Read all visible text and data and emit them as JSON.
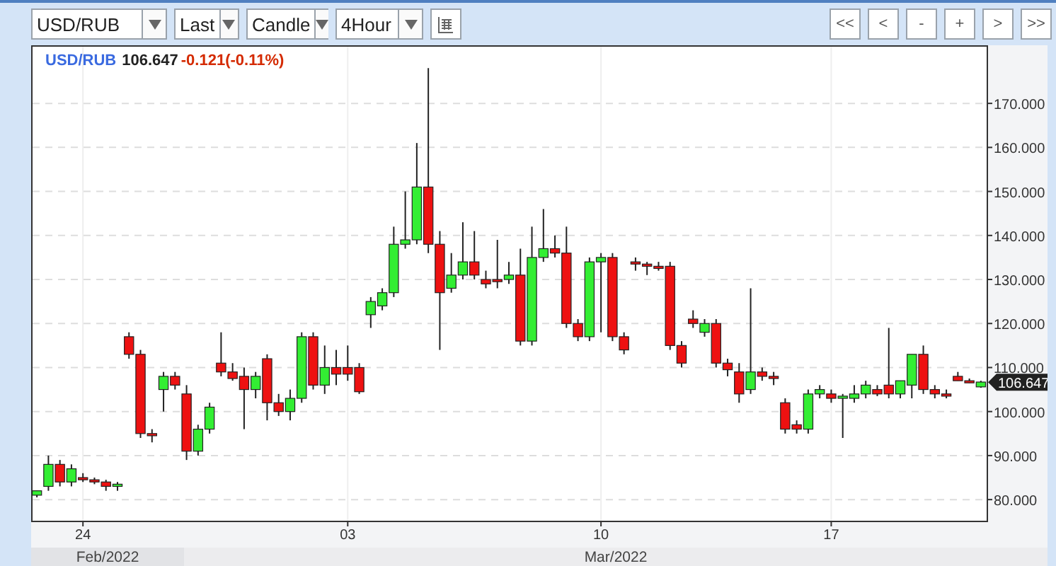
{
  "toolbar": {
    "selects": [
      {
        "value": "USD/RUB"
      },
      {
        "value": "Last"
      },
      {
        "value": "Candle"
      },
      {
        "value": "4Hour"
      }
    ],
    "nav_buttons": [
      "<<",
      "<",
      "-",
      "+",
      ">",
      ">>"
    ]
  },
  "chart": {
    "legend": {
      "symbol": "USD/RUB",
      "price": "106.647",
      "change": "-0.121(-0.11%)"
    },
    "current_price": "106.647",
    "months": [
      "Feb/2022",
      "Mar/2022"
    ],
    "chart_data": {
      "type": "candlestick",
      "grid": true,
      "ylim": [
        75.2,
        183.2
      ],
      "yticks": [
        {
          "value": 80,
          "label": "80.000"
        },
        {
          "value": 90,
          "label": "90.000"
        },
        {
          "value": 100,
          "label": "100.000"
        },
        {
          "value": 110,
          "label": "110.000"
        },
        {
          "value": 120,
          "label": "120.000"
        },
        {
          "value": 130,
          "label": "130.000"
        },
        {
          "value": 140,
          "label": "140.000"
        },
        {
          "value": 150,
          "label": "150.000"
        },
        {
          "value": 160,
          "label": "160.000"
        },
        {
          "value": 170,
          "label": "170.000"
        }
      ],
      "categories": [
        null,
        null,
        null,
        null,
        "24",
        null,
        null,
        null,
        null,
        null,
        null,
        null,
        null,
        null,
        null,
        null,
        null,
        null,
        null,
        null,
        null,
        null,
        null,
        null,
        null,
        null,
        null,
        "03",
        null,
        null,
        null,
        null,
        null,
        null,
        null,
        null,
        null,
        null,
        null,
        null,
        null,
        null,
        null,
        null,
        null,
        null,
        null,
        null,
        null,
        "10",
        null,
        null,
        null,
        null,
        null,
        null,
        null,
        null,
        null,
        null,
        null,
        null,
        null,
        null,
        null,
        null,
        null,
        null,
        null,
        "17",
        null,
        null,
        null,
        null,
        null,
        null,
        null,
        null,
        null,
        null,
        null,
        null,
        null
      ],
      "ohlc": [
        [
          81,
          82,
          80.5,
          82
        ],
        [
          83,
          90,
          82,
          88
        ],
        [
          88,
          89,
          83,
          84
        ],
        [
          84,
          88,
          83,
          87
        ],
        [
          85,
          86,
          84,
          84.5
        ],
        [
          84.5,
          85,
          83.5,
          84
        ],
        [
          84,
          84.5,
          82,
          83
        ],
        [
          83,
          84,
          82,
          83.5
        ],
        [
          117,
          118,
          112,
          113
        ],
        [
          113,
          114,
          94,
          95
        ],
        [
          95,
          96,
          93,
          94.5
        ],
        [
          105,
          109,
          100,
          108
        ],
        [
          108,
          109,
          105,
          106
        ],
        [
          104,
          106,
          89,
          91
        ],
        [
          91,
          97,
          90,
          96
        ],
        [
          96,
          102,
          95,
          101
        ],
        [
          111,
          118,
          108,
          109
        ],
        [
          109,
          111,
          107,
          107.5
        ],
        [
          108,
          110,
          96,
          105
        ],
        [
          105,
          109,
          103,
          108
        ],
        [
          112,
          113,
          98,
          102
        ],
        [
          102,
          104,
          99,
          100
        ],
        [
          100,
          105,
          98,
          103
        ],
        [
          103,
          118,
          102,
          117
        ],
        [
          117,
          118,
          105,
          106
        ],
        [
          106,
          115,
          104,
          110
        ],
        [
          110,
          114,
          106,
          108.5
        ],
        [
          110,
          115,
          107,
          108.5
        ],
        [
          110,
          111,
          104,
          104.5
        ],
        [
          122,
          126,
          119,
          125
        ],
        [
          124,
          128,
          123,
          127
        ],
        [
          127,
          142,
          126,
          138
        ],
        [
          138,
          150,
          137,
          139
        ],
        [
          139,
          161,
          138,
          151
        ],
        [
          151,
          178,
          136,
          138
        ],
        [
          138,
          141,
          114,
          127
        ],
        [
          128,
          136,
          127,
          131
        ],
        [
          131,
          143,
          130,
          134
        ],
        [
          134,
          141,
          130,
          131
        ],
        [
          130,
          132,
          128,
          129
        ],
        [
          130,
          139,
          128,
          129.5
        ],
        [
          130,
          134,
          129,
          131
        ],
        [
          131,
          137,
          115,
          116
        ],
        [
          116,
          142,
          115,
          135
        ],
        [
          135,
          146,
          134,
          137
        ],
        [
          137,
          140,
          135,
          136
        ],
        [
          136,
          142,
          119,
          120
        ],
        [
          120,
          121,
          116,
          117
        ],
        [
          117,
          135,
          116,
          134
        ],
        [
          134,
          136,
          118,
          135
        ],
        [
          135,
          136,
          116,
          117
        ],
        [
          117,
          118,
          113,
          114
        ],
        [
          134,
          135,
          132,
          133.5
        ],
        [
          133.5,
          134,
          131,
          133
        ],
        [
          133,
          134,
          132,
          132.5
        ],
        [
          133,
          134,
          114,
          115
        ],
        [
          115,
          116,
          110,
          111
        ],
        [
          121,
          123,
          119,
          120
        ],
        [
          118,
          121,
          117,
          120
        ],
        [
          120,
          121,
          110,
          111
        ],
        [
          111,
          112,
          108,
          109.5
        ],
        [
          109,
          111,
          102,
          104
        ],
        [
          105,
          128,
          104,
          109
        ],
        [
          109,
          110,
          107,
          108
        ],
        [
          108,
          109,
          106,
          107.5
        ],
        [
          102,
          103,
          95,
          96
        ],
        [
          97,
          98,
          95,
          96
        ],
        [
          96,
          105,
          95,
          104
        ],
        [
          104,
          106,
          103,
          105
        ],
        [
          104,
          105,
          102,
          103
        ],
        [
          103,
          104,
          94,
          103.5
        ],
        [
          103,
          106,
          102,
          104
        ],
        [
          104,
          107,
          103,
          106
        ],
        [
          105,
          106,
          103.5,
          104
        ],
        [
          106,
          119,
          103,
          104
        ],
        [
          104,
          107,
          103,
          107
        ],
        [
          106,
          113,
          103,
          113
        ],
        [
          113,
          115,
          104,
          105
        ],
        [
          105,
          106,
          103,
          104
        ],
        [
          104,
          105,
          103,
          103.5
        ],
        [
          108,
          109,
          107,
          107
        ],
        [
          107,
          107.5,
          106.5,
          106.8
        ],
        [
          105.6,
          107,
          105.4,
          106.7
        ]
      ]
    }
  }
}
